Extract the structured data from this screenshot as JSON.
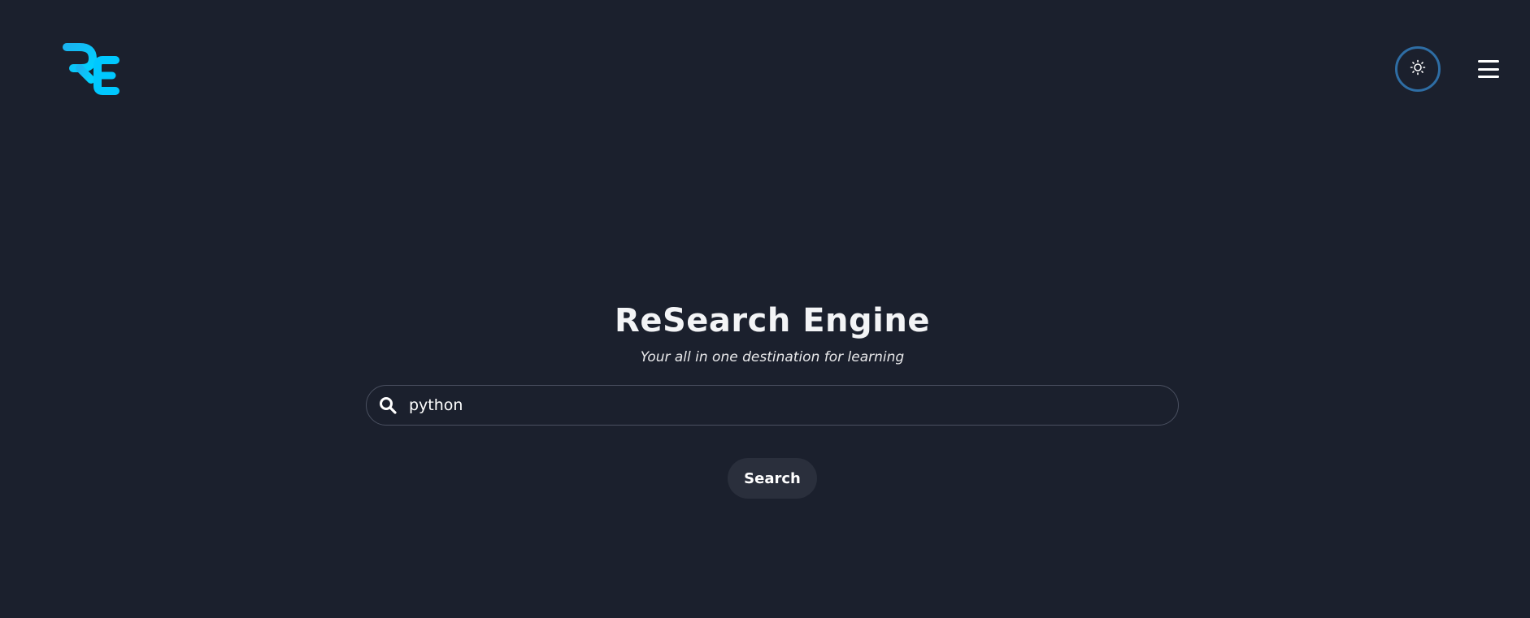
{
  "header": {
    "logo_text": "RE",
    "logo_icon": "re-logo-icon",
    "theme_toggle_icon": "sun-icon",
    "menu_icon": "hamburger-menu-icon"
  },
  "hero": {
    "title": "ReSearch Engine",
    "tagline": "Your all in one destination for learning"
  },
  "search": {
    "icon": "search-icon",
    "value": "python",
    "placeholder": "",
    "button_label": "Search"
  },
  "colors": {
    "background": "#1b202d",
    "accent": "#00c2ff",
    "toggle_border": "#2e6da4",
    "button_bg": "#2a2f3c"
  }
}
